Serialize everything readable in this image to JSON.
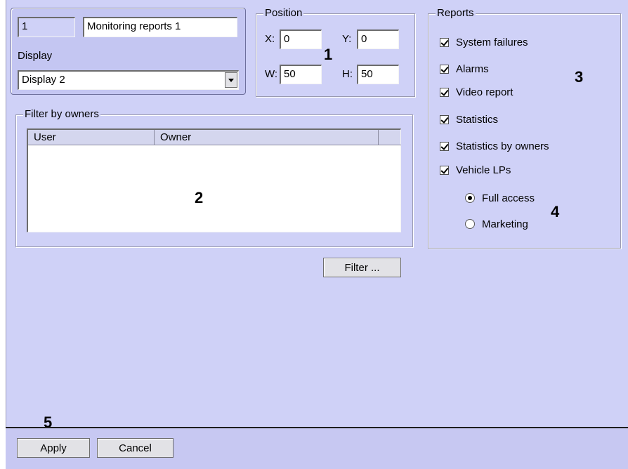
{
  "camera": {
    "id": "1",
    "name": "Monitoring reports 1",
    "display_label": "Display",
    "display_value": "Display 2"
  },
  "position": {
    "title": "Position",
    "x_label": "X:",
    "x_value": "0",
    "y_label": "Y:",
    "y_value": "0",
    "w_label": "W:",
    "w_value": "50",
    "h_label": "H:",
    "h_value": "50"
  },
  "filter": {
    "title": "Filter by owners",
    "columns": [
      "User",
      "Owner"
    ],
    "button_label": "Filter ..."
  },
  "reports": {
    "title": "Reports",
    "items": [
      {
        "label": "System failures",
        "checked": true
      },
      {
        "label": "Alarms",
        "checked": true
      },
      {
        "label": "Video report",
        "checked": true
      },
      {
        "label": "Statistics",
        "checked": true
      },
      {
        "label": "Statistics by owners",
        "checked": true
      },
      {
        "label": "Vehicle LPs",
        "checked": true
      }
    ],
    "access": [
      {
        "label": "Full access",
        "selected": true
      },
      {
        "label": "Marketing",
        "selected": false
      }
    ]
  },
  "callouts": [
    "1",
    "2",
    "3",
    "4",
    "5"
  ],
  "footer": {
    "apply_label": "Apply",
    "cancel_label": "Cancel"
  }
}
